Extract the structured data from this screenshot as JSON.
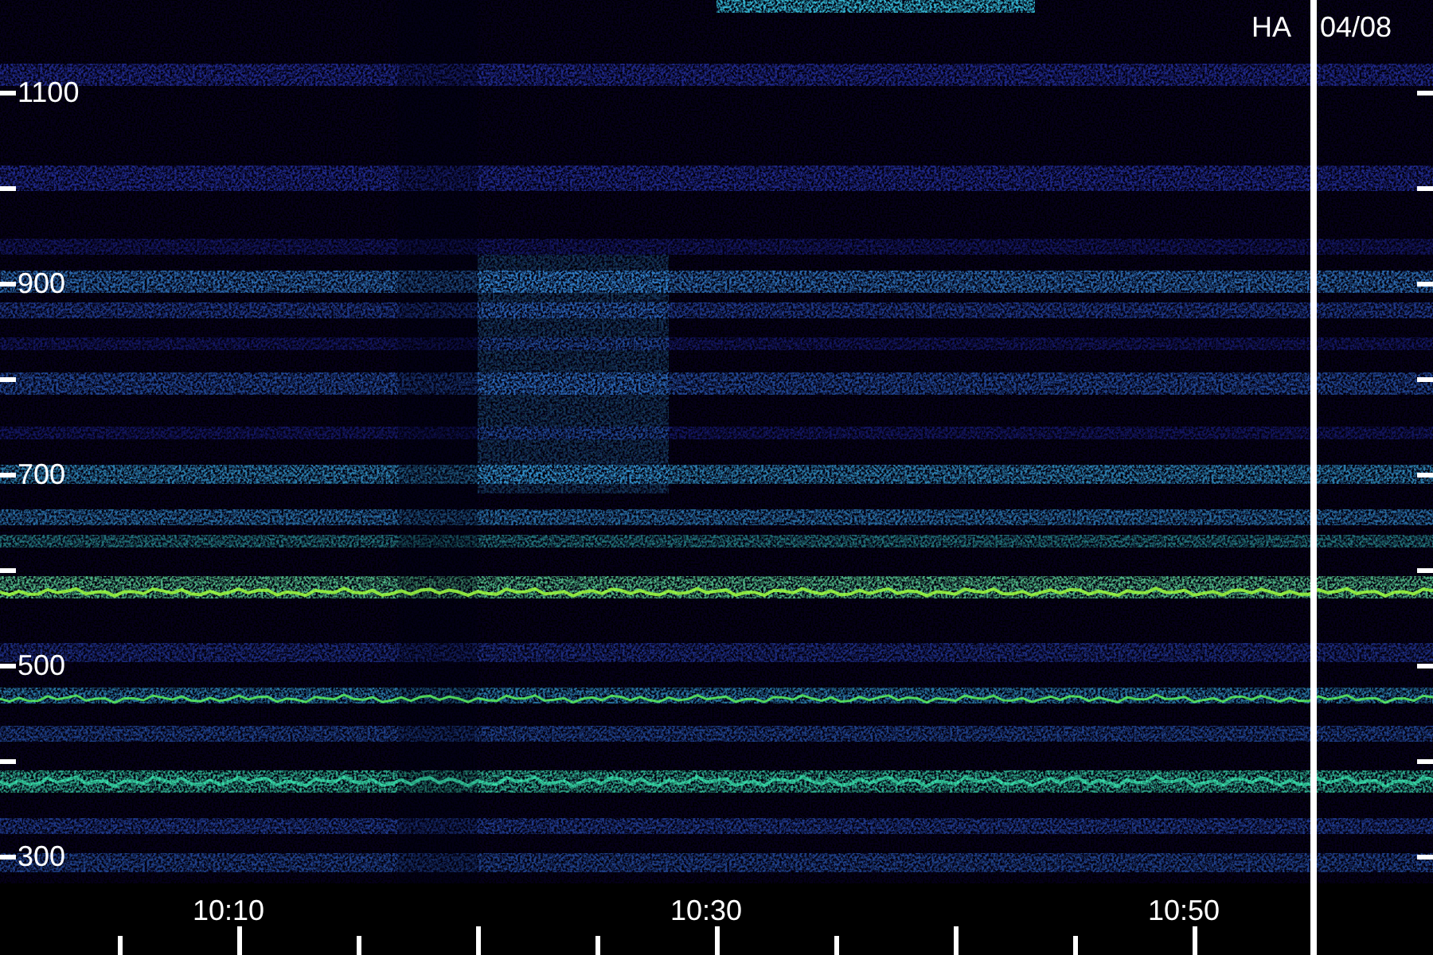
{
  "title": {
    "station": "HA",
    "date": "04/08"
  },
  "y_axis": {
    "labels": [
      "1100",
      "900",
      "700",
      "500",
      "300"
    ]
  },
  "x_axis": {
    "labels": [
      "10:10",
      "10:30",
      "10:50"
    ]
  }
}
